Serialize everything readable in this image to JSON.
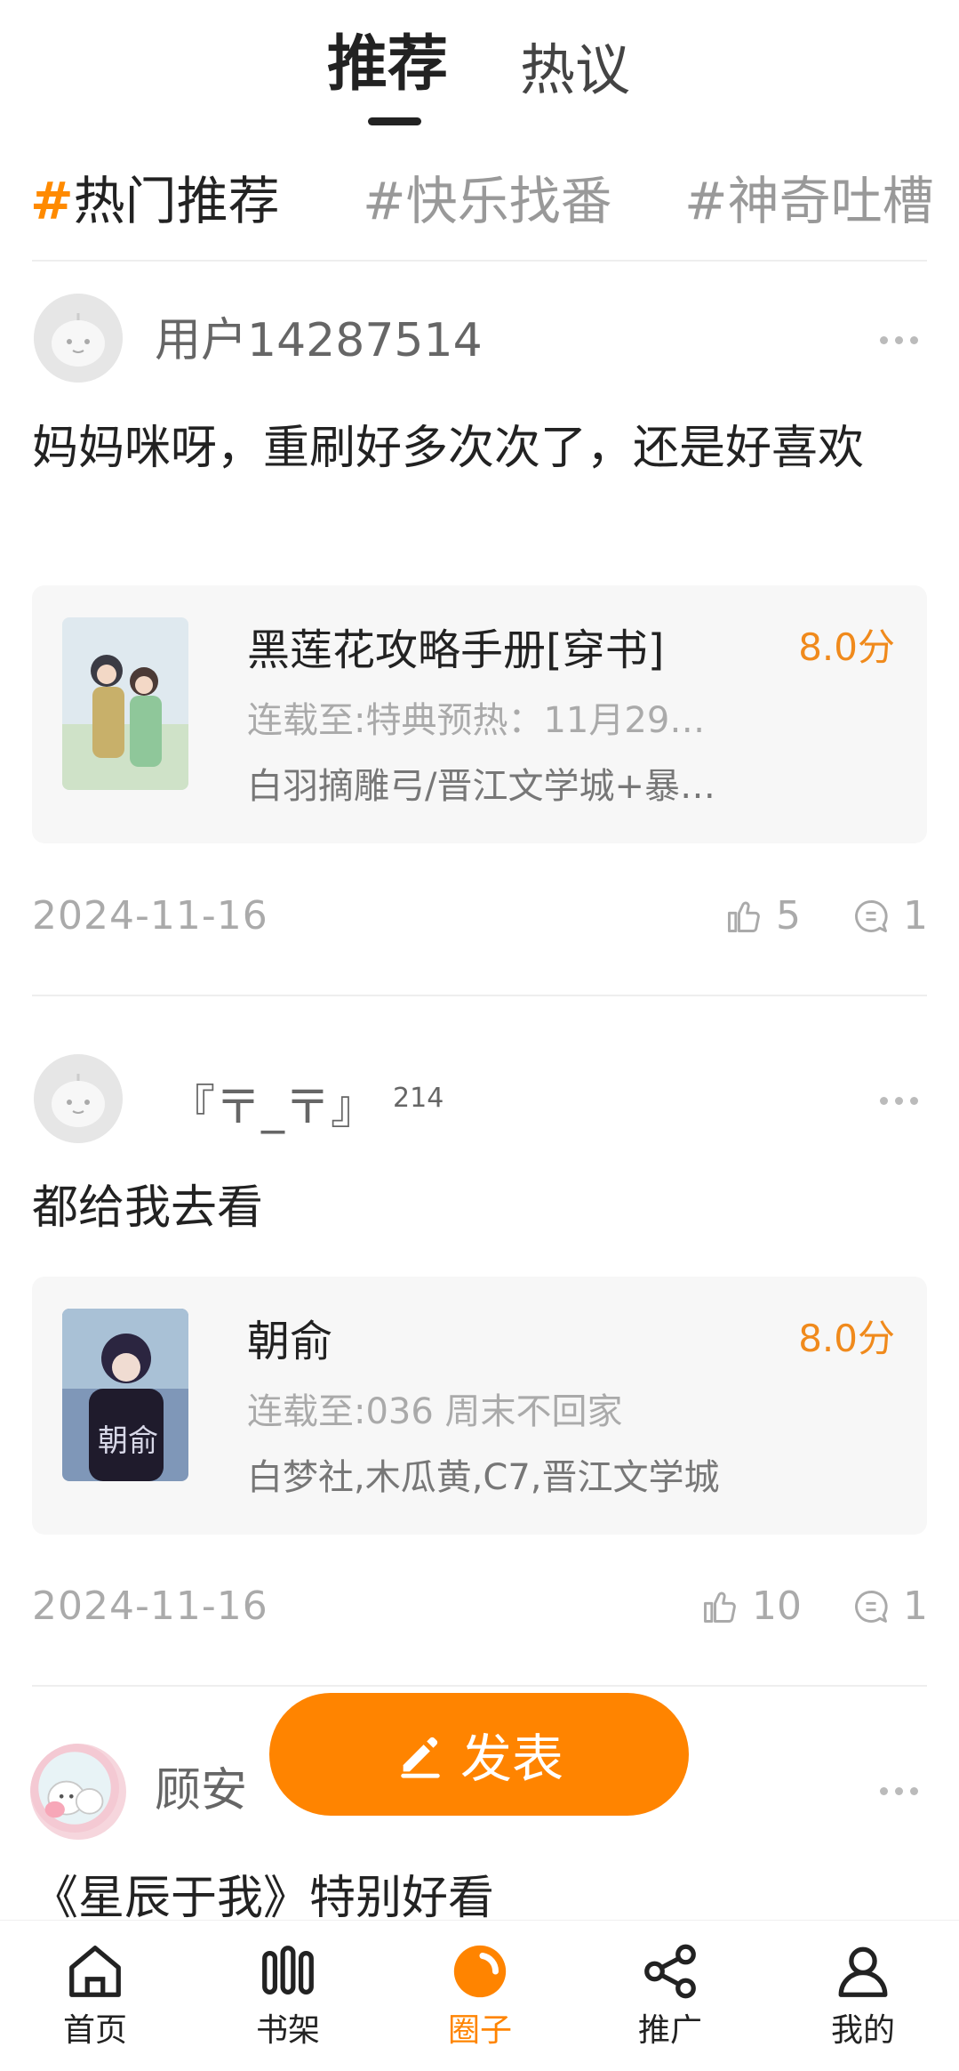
{
  "top_tabs": {
    "recommend": "推荐",
    "hot_discuss": "热议"
  },
  "hashtags": [
    {
      "hash": "#",
      "label": "热门推荐"
    },
    {
      "hash": "#",
      "label": "快乐找番"
    },
    {
      "hash": "#",
      "label": "神奇吐槽"
    }
  ],
  "posts": [
    {
      "username": "用户14287514",
      "badge": "",
      "text": "妈妈咪呀，重刷好多次次了，还是好喜欢",
      "book": {
        "title": "黑莲花攻略手册[穿书]",
        "score": "8.0分",
        "progress": "连载至:特典预热：11月29…",
        "tags": "白羽摘雕弓/晋江文学城+暴…"
      },
      "date": "2024-11-16",
      "likes": "5",
      "comments": "1"
    },
    {
      "username": "『〒_〒』",
      "badge": "214",
      "text": "都给我去看",
      "book": {
        "title": "朝俞",
        "score": "8.0分",
        "progress": "连载至:036 周末不回家",
        "tags": "白梦社,木瓜黄,C7,晋江文学城"
      },
      "date": "2024-11-16",
      "likes": "10",
      "comments": "1"
    },
    {
      "username": "顾安",
      "text": "《星辰于我》特别好看"
    }
  ],
  "publish_button": "发表",
  "bottom_nav": [
    {
      "label": "首页",
      "icon": "home-icon"
    },
    {
      "label": "书架",
      "icon": "bookshelf-icon"
    },
    {
      "label": "圈子",
      "icon": "circle-icon",
      "active": true
    },
    {
      "label": "推广",
      "icon": "share-icon"
    },
    {
      "label": "我的",
      "icon": "profile-icon"
    }
  ],
  "colors": {
    "accent": "#ff8400",
    "score": "#f08a1c"
  }
}
